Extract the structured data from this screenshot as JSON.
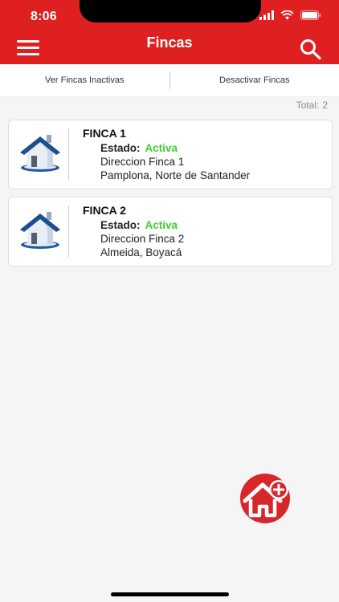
{
  "status_bar": {
    "time": "8:06"
  },
  "header": {
    "title": "Fincas"
  },
  "toolbar": {
    "left_label": "Ver Fincas Inactivas",
    "right_label": "Desactivar Fincas"
  },
  "summary": {
    "total_label": "Total:",
    "total_value": "2"
  },
  "fincas": [
    {
      "name": "FINCA 1",
      "estado_label": "Estado:",
      "estado_value": "Activa",
      "direccion": "Direccion Finca 1",
      "ubicacion": "Pamplona, Norte de Santander"
    },
    {
      "name": "FINCA 2",
      "estado_label": "Estado:",
      "estado_value": "Activa",
      "direccion": "Direccion Finca 2",
      "ubicacion": "Almeida, Boyacá"
    }
  ],
  "colors": {
    "brand": "#df2020",
    "active": "#3fcf2f"
  },
  "icons": {
    "menu": "menu-icon",
    "search": "search-icon",
    "house": "house-icon",
    "add_house": "add-house-icon"
  }
}
